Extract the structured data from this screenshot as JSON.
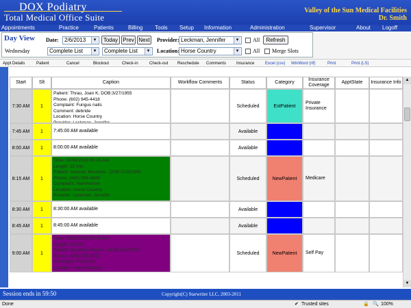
{
  "header": {
    "brand_line1": "DOX Podiatry",
    "brand_line2": "Total Medical Office Suite",
    "facility": "Valley of the Sun Medical Facilities",
    "doctor": "Dr. Smith"
  },
  "menu": [
    "Appointments",
    "Practice",
    "Patients",
    "Billing",
    "Tools",
    "Setup",
    "Information",
    "Administration",
    "Supervisor",
    "About",
    "Logoff"
  ],
  "controls": {
    "title": "Day View",
    "weekday": "Wednesday",
    "date_label": "Date:",
    "date_value": "2/6/2013",
    "today": "Today",
    "prev": "Prev",
    "next": "Next",
    "provider_label": "Provider:",
    "provider_value": "Leckman, Jennifer",
    "all_label_1": "All",
    "refresh": "Refresh",
    "list_1": "Complete List",
    "list_2": "Complete List",
    "location_label": "Location:",
    "location_value": "Horse Country",
    "all_label_2": "All",
    "merge_label": "Merge Slots"
  },
  "toolbar": [
    "Appt Details",
    "Patient",
    "Cancel",
    "Blockout",
    "Check-in",
    "Check-out",
    "Reschedule",
    "Comments",
    "Insurance",
    "Excel (csv)",
    "WinWord (rtf)",
    "Print",
    "Print (LS)"
  ],
  "columns": [
    "Start",
    "Slt",
    "Caption",
    "Workflow Comments",
    "Status",
    "Category",
    "Insurance Coverage",
    "ApptState",
    "Insurance Info"
  ],
  "rows": [
    {
      "start": "7:30 AM",
      "slt": "1",
      "caption": [
        "Patient: Thrau, Joan K, DOB:3/27/1955",
        "Phone: (602) 945-4418",
        "Complaint: Fungus nails",
        "Comment: debride",
        "Location: Horse Country",
        "Provider: Leckman, Jennifer"
      ],
      "status": "Scheduled",
      "category": "EstPatient",
      "category_color": "#3fe0c8",
      "caption_color": "#ffffff",
      "insurance": "Private Insurance"
    },
    {
      "start": "7:45 AM",
      "slt": "1",
      "caption": [
        "7:45:00 AM available"
      ],
      "status": "Available",
      "category": "",
      "category_color": "#0000ff",
      "caption_color": "#ffffff",
      "insurance": ""
    },
    {
      "start": "8:00 AM",
      "slt": "1",
      "caption": [
        "8:00:00 AM available"
      ],
      "status": "Available",
      "category": "",
      "category_color": "#0000ff",
      "caption_color": "#ffffff",
      "insurance": ""
    },
    {
      "start": "8:15 AM",
      "slt": "1",
      "caption": [
        "Time: 02/06/2013 08:15 AM",
        "Length: 15 min.",
        "Patient: Jousulo, Bevanne , DOB:2/18/1960",
        "Phone: (480) 556-6699",
        "Complaint: Hammertoe",
        "Location: Horse Country",
        "Provider: Leckman, Jennifer"
      ],
      "status": "Scheduled",
      "category": "NewPatient",
      "category_color": "#f08070",
      "caption_color": "#008000",
      "insurance": "Medicare"
    },
    {
      "start": "8:30 AM",
      "slt": "1",
      "caption": [
        "8:30:00 AM available"
      ],
      "status": "Available",
      "category": "",
      "category_color": "#0000ff",
      "caption_color": "#ffffff",
      "insurance": ""
    },
    {
      "start": "8:45 AM",
      "slt": "1",
      "caption": [
        "8:45:00 AM available"
      ],
      "status": "Available",
      "category": "",
      "category_color": "#0000ff",
      "caption_color": "#ffffff",
      "insurance": ""
    },
    {
      "start": "9:00 AM",
      "slt": "1",
      "caption": [
        "Time: 02/06/2013 09:00 AM",
        "Length: 15 min.",
        "Patient: (Sucker), Sharon , DOB:3/15/2000",
        "Phone: (480) 555-6721",
        "Complaint: Foot Pain",
        "Location: Horse Country",
        "Provider: Leckman, Jennifer"
      ],
      "status": "Scheduled",
      "category": "NewPatient",
      "category_color": "#f08070",
      "caption_color": "#800080",
      "insurance": "Self Pay"
    }
  ],
  "footer": {
    "session": "Session ends in 59:50",
    "copyright": "Copyright(C) Starwriter LLC, 2003-2011"
  },
  "statusbar": {
    "done": "Done",
    "trusted": "Trusted sites",
    "zoom": "100%"
  }
}
